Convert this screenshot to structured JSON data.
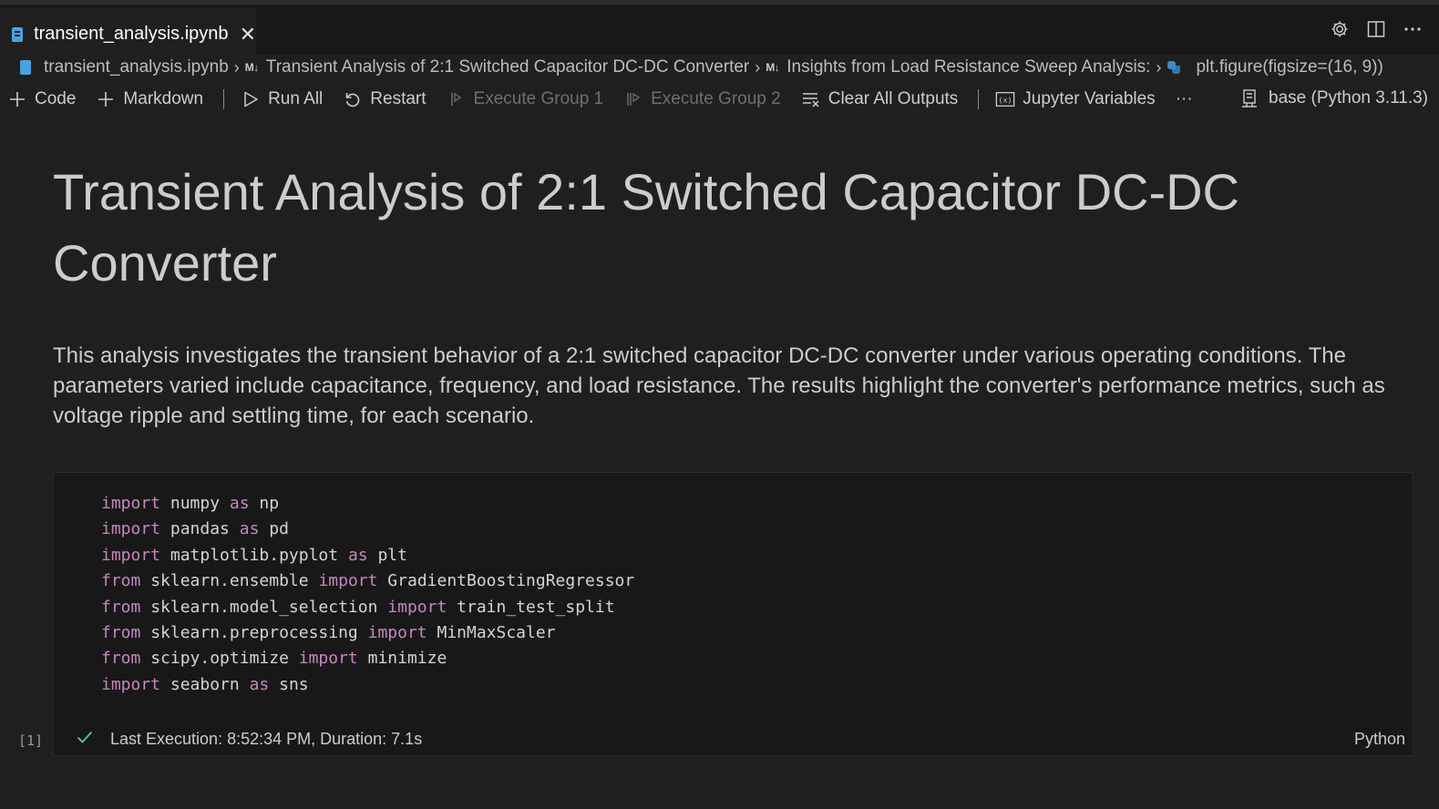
{
  "tab": {
    "title": "transient_analysis.ipynb",
    "close_glyph": "✕"
  },
  "breadcrumb": {
    "file": "transient_analysis.ipynb",
    "md_badge_1": "M↓",
    "heading": "Transient Analysis of 2:1 Switched Capacitor DC-DC Converter",
    "md_badge_2": "M↓",
    "subheading": "Insights from Load Resistance Sweep Analysis:",
    "cell": "plt.figure(figsize=(16, 9))"
  },
  "toolbar": {
    "code_label": "Code",
    "markdown_label": "Markdown",
    "run_all_label": "Run All",
    "restart_label": "Restart",
    "execute_group_1_label": "Execute Group 1",
    "execute_group_2_label": "Execute Group 2",
    "clear_outputs_label": "Clear All Outputs",
    "jupyter_variables_label": "Jupyter Variables",
    "more_label": "···",
    "kernel_label": "base (Python 3.11.3)"
  },
  "markdown": {
    "title": "Transient Analysis of 2:1 Switched Capacitor DC-DC Converter",
    "paragraph": "This analysis investigates the transient behavior of a 2:1 switched capacitor DC-DC converter under various operating conditions. The parameters varied include capacitance, frequency, and load resistance. The results highlight the converter's performance metrics, such as voltage ripple and settling time, for each scenario."
  },
  "code_cell": {
    "lines": [
      [
        [
          "import",
          "kw"
        ],
        [
          " numpy ",
          ""
        ],
        [
          "as",
          "kw"
        ],
        [
          " np",
          ""
        ]
      ],
      [
        [
          "import",
          "kw"
        ],
        [
          " pandas ",
          ""
        ],
        [
          "as",
          "kw"
        ],
        [
          " pd",
          ""
        ]
      ],
      [
        [
          "import",
          "kw"
        ],
        [
          " matplotlib.pyplot ",
          ""
        ],
        [
          "as",
          "kw"
        ],
        [
          " plt",
          ""
        ]
      ],
      [
        [
          "from",
          "kw"
        ],
        [
          " sklearn.ensemble ",
          ""
        ],
        [
          "import",
          "kw"
        ],
        [
          " GradientBoostingRegressor",
          ""
        ]
      ],
      [
        [
          "from",
          "kw"
        ],
        [
          " sklearn.model_selection ",
          ""
        ],
        [
          "import",
          "kw"
        ],
        [
          " train_test_split",
          ""
        ]
      ],
      [
        [
          "from",
          "kw"
        ],
        [
          " sklearn.preprocessing ",
          ""
        ],
        [
          "import",
          "kw"
        ],
        [
          " MinMaxScaler",
          ""
        ]
      ],
      [
        [
          "from",
          "kw"
        ],
        [
          " scipy.optimize ",
          ""
        ],
        [
          "import",
          "kw"
        ],
        [
          " minimize",
          ""
        ]
      ],
      [
        [
          "import",
          "kw"
        ],
        [
          " seaborn ",
          ""
        ],
        [
          "as",
          "kw"
        ],
        [
          " sns",
          ""
        ]
      ]
    ],
    "execution_count": "[1]",
    "status": "Last Execution: 8:52:34 PM, Duration: 7.1s",
    "language": "Python"
  },
  "colors": {
    "background": "#1f1f1f",
    "keyword": "#c586c0",
    "success": "#4ec9b0"
  }
}
